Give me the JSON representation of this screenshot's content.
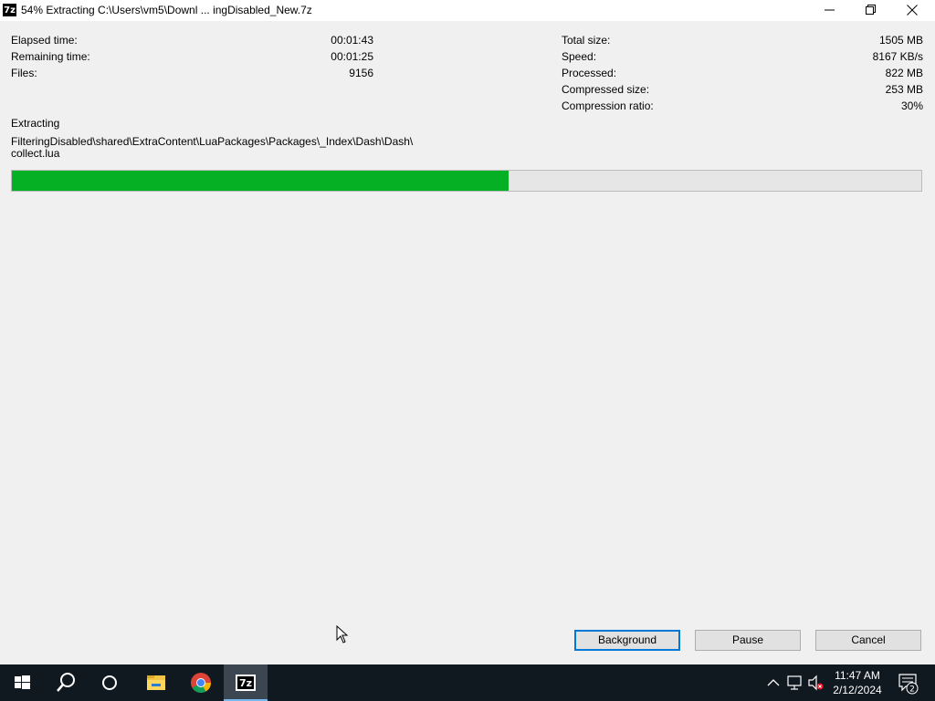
{
  "window": {
    "title": "54% Extracting C:\\Users\\vm5\\Downl ... ingDisabled_New.7z",
    "icon_text": "7z"
  },
  "stats_left": [
    {
      "label": "Elapsed time:",
      "value": "00:01:43"
    },
    {
      "label": "Remaining time:",
      "value": "00:01:25"
    },
    {
      "label": "Files:",
      "value": "9156"
    }
  ],
  "stats_right": [
    {
      "label": "Total size:",
      "value": "1505 MB"
    },
    {
      "label": "Speed:",
      "value": "8167 KB/s"
    },
    {
      "label": "Processed:",
      "value": "822 MB"
    },
    {
      "label": "Compressed size:",
      "value": "253 MB"
    },
    {
      "label": "Compression ratio:",
      "value": "30%"
    }
  ],
  "status": {
    "heading": "Extracting",
    "path_line1": "FilteringDisabled\\shared\\ExtraContent\\LuaPackages\\Packages\\_Index\\Dash\\Dash\\",
    "path_line2": "collect.lua"
  },
  "progress": {
    "fraction": 0.546,
    "color": "#06b025"
  },
  "buttons": {
    "background": "Background",
    "pause": "Pause",
    "cancel": "Cancel"
  },
  "taskbar": {
    "apps": [
      "start-icon",
      "search-icon",
      "task-view-icon",
      "file-explorer-icon",
      "chrome-icon",
      "7zip-icon"
    ],
    "time": "11:47 AM",
    "date": "2/12/2024",
    "notification_count": "2"
  }
}
